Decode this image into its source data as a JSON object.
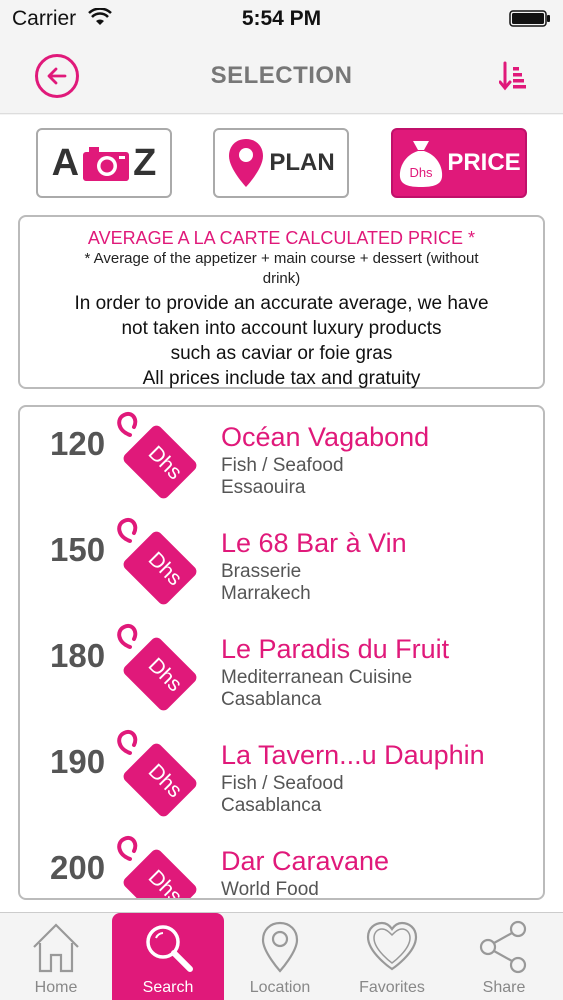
{
  "status": {
    "carrier": "Carrier",
    "time": "5:54 PM"
  },
  "nav": {
    "title": "SELECTION",
    "back_icon": "back-arrow-icon",
    "sort_icon": "sort-icon"
  },
  "filters": {
    "az": {
      "left": "A",
      "right": "Z",
      "icon": "camera-icon"
    },
    "plan": {
      "label": "PLAN",
      "icon": "map-pin-icon"
    },
    "price": {
      "label": "PRICE",
      "badge": "Dhs",
      "icon": "money-bag-icon"
    }
  },
  "info": {
    "title": "AVERAGE A LA CARTE CALCULATED PRICE *",
    "subtitle": "* Average of the appetizer + main course + dessert (without drink)",
    "line1": "In order to provide an accurate average, we have",
    "line2": "not taken into account luxury products",
    "line3": "such as caviar or foie gras",
    "line4": "All prices include tax and gratuity"
  },
  "tag_label": "Dhs",
  "restaurants": [
    {
      "price": "120",
      "name": "Océan Vagabond",
      "category": "Fish / Seafood",
      "city": "Essaouira"
    },
    {
      "price": "150",
      "name": "Le 68 Bar à Vin",
      "category": "Brasserie",
      "city": "Marrakech"
    },
    {
      "price": "180",
      "name": "Le Paradis du Fruit",
      "category": "Mediterranean Cuisine",
      "city": "Casablanca"
    },
    {
      "price": "190",
      "name": "La Tavern...u Dauphin",
      "category": "Fish / Seafood",
      "city": "Casablanca"
    },
    {
      "price": "200",
      "name": "Dar Caravane",
      "category": "World Food",
      "city": ""
    }
  ],
  "tabs": [
    {
      "label": "Home",
      "icon": "home-icon"
    },
    {
      "label": "Search",
      "icon": "search-icon"
    },
    {
      "label": "Location",
      "icon": "location-icon"
    },
    {
      "label": "Favorites",
      "icon": "heart-icon"
    },
    {
      "label": "Share",
      "icon": "share-icon"
    }
  ],
  "colors": {
    "accent": "#e0197a",
    "text_gray": "#555555",
    "border": "#bbbbbb"
  }
}
